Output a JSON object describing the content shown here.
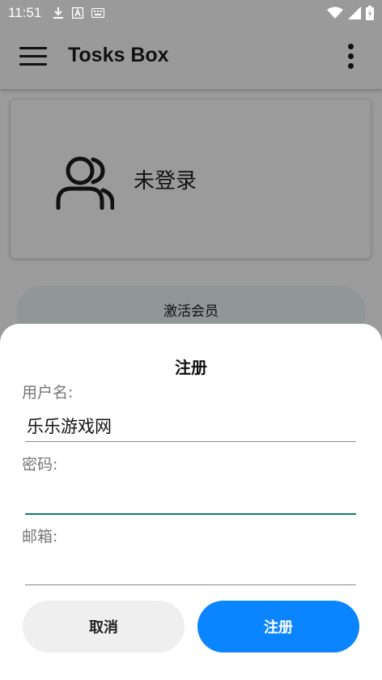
{
  "status_bar": {
    "time": "11:51",
    "icons": [
      "download-icon",
      "a-letter-icon",
      "keyboard-icon",
      "wifi-icon",
      "signal-icon",
      "battery-icon"
    ]
  },
  "app_bar": {
    "title": "Tosks Box",
    "left_icon": "menu-icon",
    "right_icon": "more-vert-icon"
  },
  "user_card": {
    "icon": "users-icon",
    "login_status": "未登录"
  },
  "vip_button_label": "激活会员",
  "dialog": {
    "title": "注册",
    "fields": {
      "username": {
        "label": "用户名:",
        "value": "乐乐游戏网"
      },
      "password": {
        "label": "密码:",
        "value": ""
      },
      "email": {
        "label": "邮箱:",
        "value": ""
      }
    },
    "cancel_label": "取消",
    "register_label": "注册"
  },
  "colors": {
    "accent_blue": "#0a84ff",
    "focus_teal": "#0d7f6f",
    "scrim_gray": "#9b9b9b"
  }
}
